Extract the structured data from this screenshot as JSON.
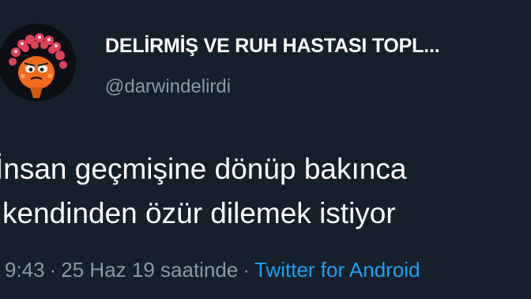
{
  "tweet": {
    "display_name": "DELİRMİŞ VE RUH HASTASI TOPL...",
    "handle": "@darwindelirdi",
    "text_lines": [
      "İnsan geçmişine dönüp bakınca",
      "kendinden özür dilemek istiyor"
    ],
    "time": "9:43",
    "separator": "·",
    "date": "25 Haz 19 saatinde",
    "source": "Twitter for Android"
  },
  "avatar": {
    "icon": "cartoon-character-avatar-icon",
    "colors": {
      "background": "#0b0f14",
      "face": "#f26a1b",
      "hearts": "#e0405a"
    }
  },
  "colors": {
    "background": "#15202b",
    "primary_text": "#ffffff",
    "secondary_text": "#8899a6",
    "link": "#1da1f2"
  }
}
